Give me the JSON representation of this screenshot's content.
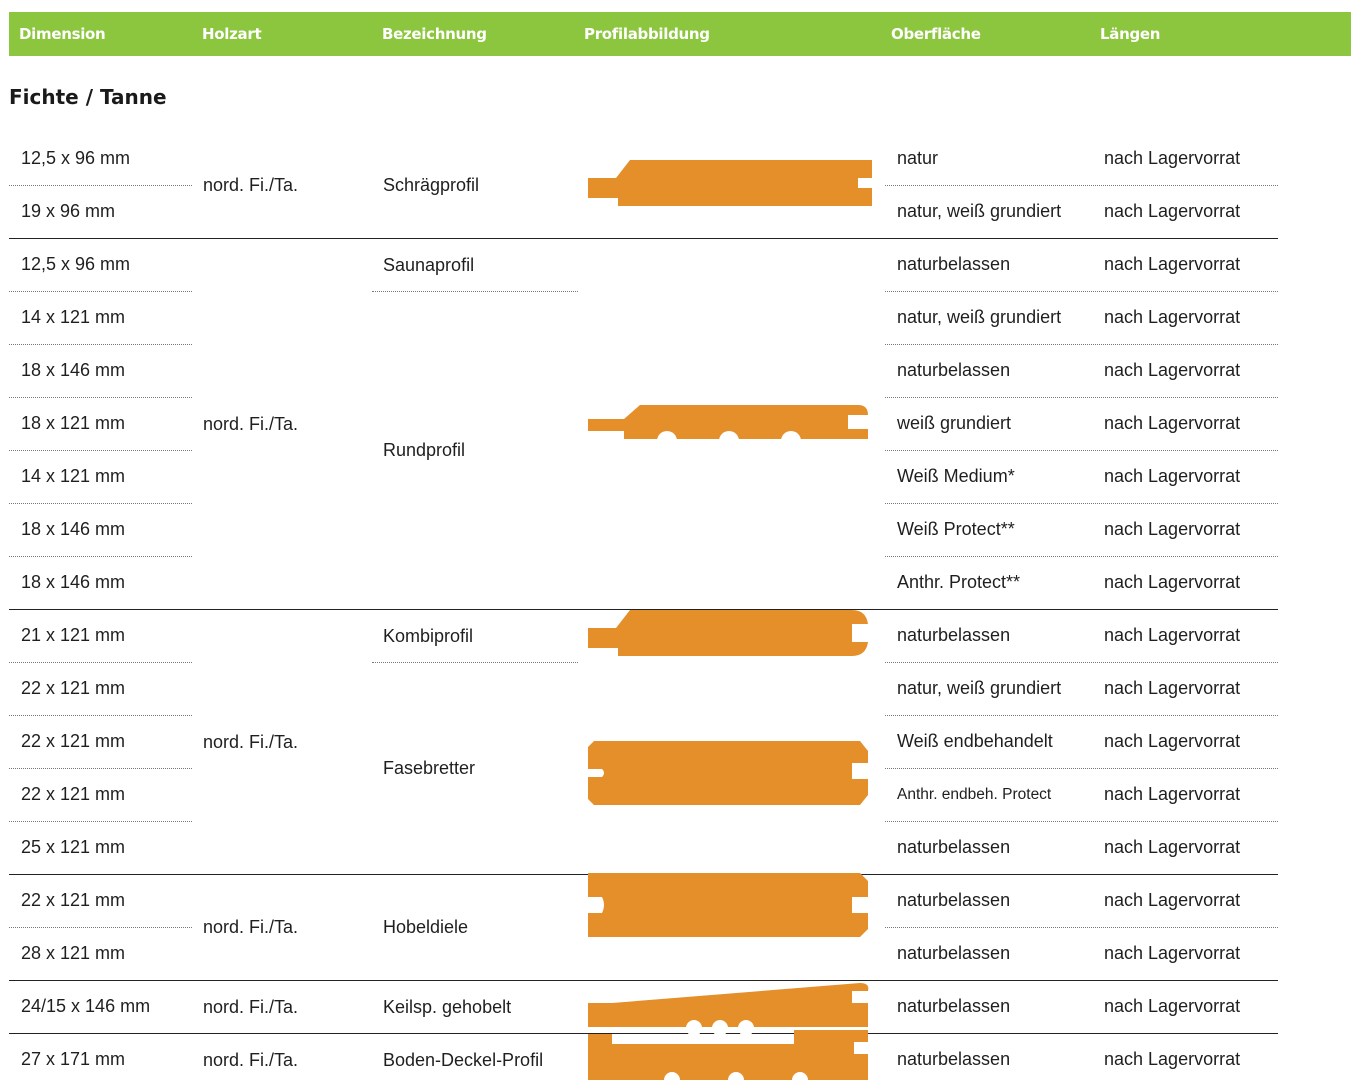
{
  "header": {
    "columns": [
      "Dimension",
      "Holzart",
      "Bezeichnung",
      "Profilabbildung",
      "Oberfläche",
      "Längen"
    ],
    "color": "#8cc63f"
  },
  "section_title": "Fichte / Tanne",
  "profile_color": "#e48f2a",
  "rows": [
    {
      "dimension": "12,5 x 96 mm",
      "surface": "natur",
      "length": "nach Lagervorrat"
    },
    {
      "dimension": "19 x 96 mm",
      "surface": "natur, weiß grundiert",
      "length": "nach Lagervorrat"
    },
    {
      "dimension": "12,5 x 96 mm",
      "surface": "naturbelassen",
      "length": "nach Lagervorrat"
    },
    {
      "dimension": "14 x 121 mm",
      "surface": "natur, weiß grundiert",
      "length": "nach Lagervorrat"
    },
    {
      "dimension": "18 x 146 mm",
      "surface": "naturbelassen",
      "length": "nach Lagervorrat"
    },
    {
      "dimension": "18 x 121 mm",
      "surface": "weiß grundiert",
      "length": "nach Lagervorrat"
    },
    {
      "dimension": "14 x 121 mm",
      "surface": "Weiß Medium*",
      "length": "nach Lagervorrat"
    },
    {
      "dimension": "18 x 146 mm",
      "surface": "Weiß Protect**",
      "length": "nach Lagervorrat"
    },
    {
      "dimension": "18 x 146 mm",
      "surface": "Anthr. Protect**",
      "length": "nach Lagervorrat"
    },
    {
      "dimension": "21 x 121 mm",
      "surface": "naturbelassen",
      "length": "nach Lagervorrat"
    },
    {
      "dimension": "22 x 121 mm",
      "surface": "natur, weiß grundiert",
      "length": "nach Lagervorrat"
    },
    {
      "dimension": "22 x 121 mm",
      "surface": "Weiß endbehandelt",
      "length": "nach Lagervorrat"
    },
    {
      "dimension": "22 x 121 mm",
      "surface": "Anthr. endbeh. Protect",
      "length": "nach Lagervorrat"
    },
    {
      "dimension": "25 x 121 mm",
      "surface": "naturbelassen",
      "length": "nach Lagervorrat"
    },
    {
      "dimension": "22 x 121 mm",
      "surface": "naturbelassen",
      "length": "nach Lagervorrat"
    },
    {
      "dimension": "28 x 121 mm",
      "surface": "naturbelassen",
      "length": "nach Lagervorrat"
    },
    {
      "dimension": "24/15 x 146 mm",
      "surface": "naturbelassen",
      "length": "nach Lagervorrat"
    },
    {
      "dimension": "27 x 171 mm",
      "surface": "naturbelassen",
      "length": "nach Lagervorrat"
    }
  ],
  "groups": [
    {
      "wood": "nord. Fi./Ta.",
      "names": [
        "Schrägprofil"
      ]
    },
    {
      "wood": "nord. Fi./Ta.",
      "names": [
        "Saunaprofil",
        "Rundprofil"
      ]
    },
    {
      "wood": "nord. Fi./Ta.",
      "names": [
        "Kombiprofil",
        "Fasebretter"
      ]
    },
    {
      "wood": "nord. Fi./Ta.",
      "names": [
        "Hobeldiele"
      ]
    },
    {
      "wood": "nord. Fi./Ta.",
      "names": [
        "Keilsp. gehobelt"
      ]
    },
    {
      "wood": "nord. Fi./Ta.",
      "names": [
        "Boden-Deckel-Profil"
      ]
    }
  ]
}
